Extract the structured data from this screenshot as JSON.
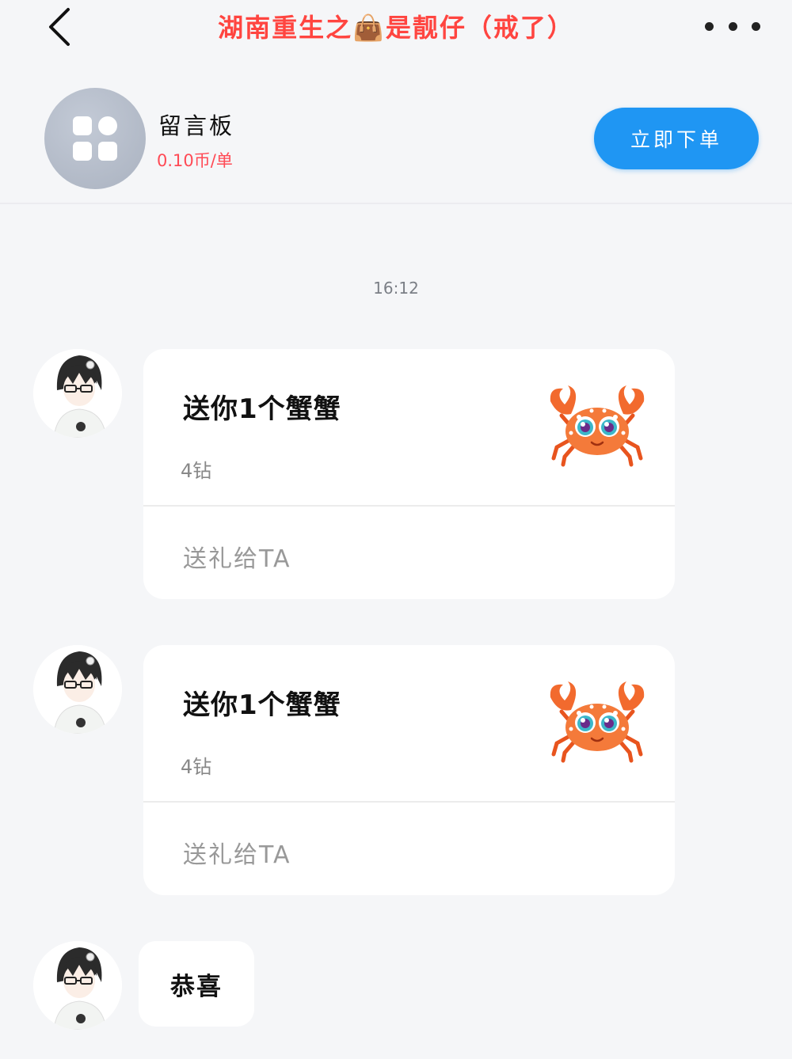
{
  "header": {
    "title": "湖南重生之👜是靓仔（戒了）",
    "title_color": "#ff4540"
  },
  "service": {
    "name": "留言板",
    "price": "0.10币/单",
    "order_button": "立即下单"
  },
  "chat": {
    "timestamp": "16:12",
    "messages": [
      {
        "type": "gift",
        "title": "送你1个蟹蟹",
        "cost": "4钻",
        "action": "送礼给TA",
        "gift_icon": "crab-icon"
      },
      {
        "type": "gift",
        "title": "送你1个蟹蟹",
        "cost": "4钻",
        "action": "送礼给TA",
        "gift_icon": "crab-icon"
      },
      {
        "type": "text",
        "text": "恭喜"
      }
    ]
  },
  "colors": {
    "accent": "#1f96f3",
    "price": "#ff4a55",
    "background": "#f5f6f8"
  }
}
